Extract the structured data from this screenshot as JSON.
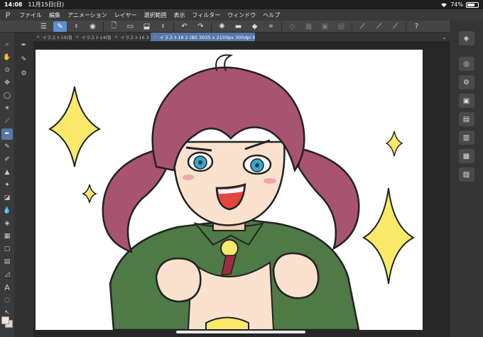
{
  "status": {
    "time": "14:08",
    "date": "11月15日(日)",
    "battery": "74%",
    "battery_level": 0.74,
    "wifi_icon": "wifi-icon"
  },
  "menu": {
    "items": [
      "ファイル",
      "編集",
      "アニメーション",
      "レイヤー",
      "選択範囲",
      "表示",
      "フィルター",
      "ウィンドウ",
      "ヘルプ"
    ]
  },
  "tabs": [
    {
      "label": "イラスト10(保"
    },
    {
      "label": "イラスト14(保"
    },
    {
      "label": "イラスト16 3"
    },
    {
      "label": "イラスト16 2 (B5 3035 x 2150px 300dpi 63.4%)"
    }
  ],
  "colors": {
    "accent": "#5578a8",
    "hair": "#a85470",
    "coat": "#4e7a45",
    "skin": "#fbe2cf",
    "sparkle": "#fbe96a",
    "eye": "#3aa7c9",
    "foreground_swatch": "#f2e6d8",
    "background_swatch": "#d8d8d8"
  }
}
